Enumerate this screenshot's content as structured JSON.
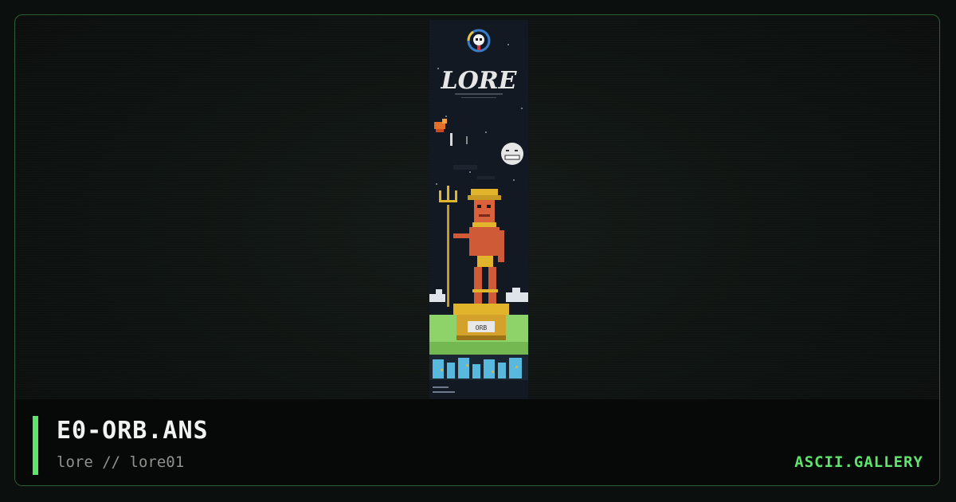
{
  "artwork": {
    "logo_text": "LORE",
    "plaque_text": "ORB"
  },
  "footer": {
    "filename": "E0-ORB.ANS",
    "breadcrumb": "lore // lore01",
    "brand": "ASCII.GALLERY"
  },
  "colors": {
    "accent": "#5ee46d",
    "border": "#2c5f36",
    "background": "#0b0f0d"
  }
}
